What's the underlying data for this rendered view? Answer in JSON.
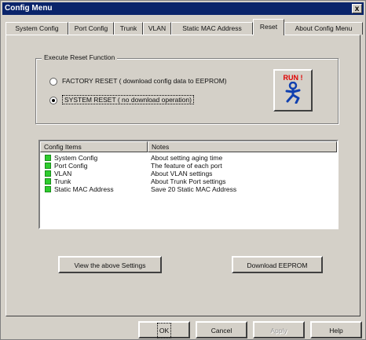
{
  "window": {
    "title": "Config Menu",
    "close_label": "x"
  },
  "tabs": [
    {
      "label": "System Config"
    },
    {
      "label": "Port Config"
    },
    {
      "label": "Trunk"
    },
    {
      "label": "VLAN"
    },
    {
      "label": "Static MAC Address"
    },
    {
      "label": "Reset"
    },
    {
      "label": "About Config Menu"
    }
  ],
  "active_tab": "Reset",
  "reset_group": {
    "legend": "Execute Reset Function",
    "options": [
      {
        "label": "FACTORY RESET ( download config data to EEPROM)",
        "checked": false
      },
      {
        "label": "SYSTEM RESET ( no download operation)",
        "checked": true
      }
    ],
    "run_label": "RUN !"
  },
  "config_list": {
    "columns": [
      "Config Items",
      "Notes"
    ],
    "rows": [
      {
        "item": "System Config",
        "note": "About setting aging time"
      },
      {
        "item": "Port Config",
        "note": "The feature of each port"
      },
      {
        "item": "VLAN",
        "note": "About VLAN settings"
      },
      {
        "item": "Trunk",
        "note": "About Trunk Port settings"
      },
      {
        "item": "Static MAC Address",
        "note": "Save 20 Static MAC Address"
      }
    ]
  },
  "actions": {
    "view_settings": "View the above Settings",
    "download_eeprom": "Download EEPROM"
  },
  "footer": {
    "ok": "OK",
    "cancel": "Cancel",
    "apply": "Apply",
    "help": "Help"
  },
  "colors": {
    "title_bar": "#0a246a",
    "run_text": "#e00000",
    "item_icon": "#2ecc2e",
    "run_figure": "#1040b0"
  },
  "icons": {
    "item_icon": "green-square-icon",
    "run_icon": "person-running-icon"
  }
}
